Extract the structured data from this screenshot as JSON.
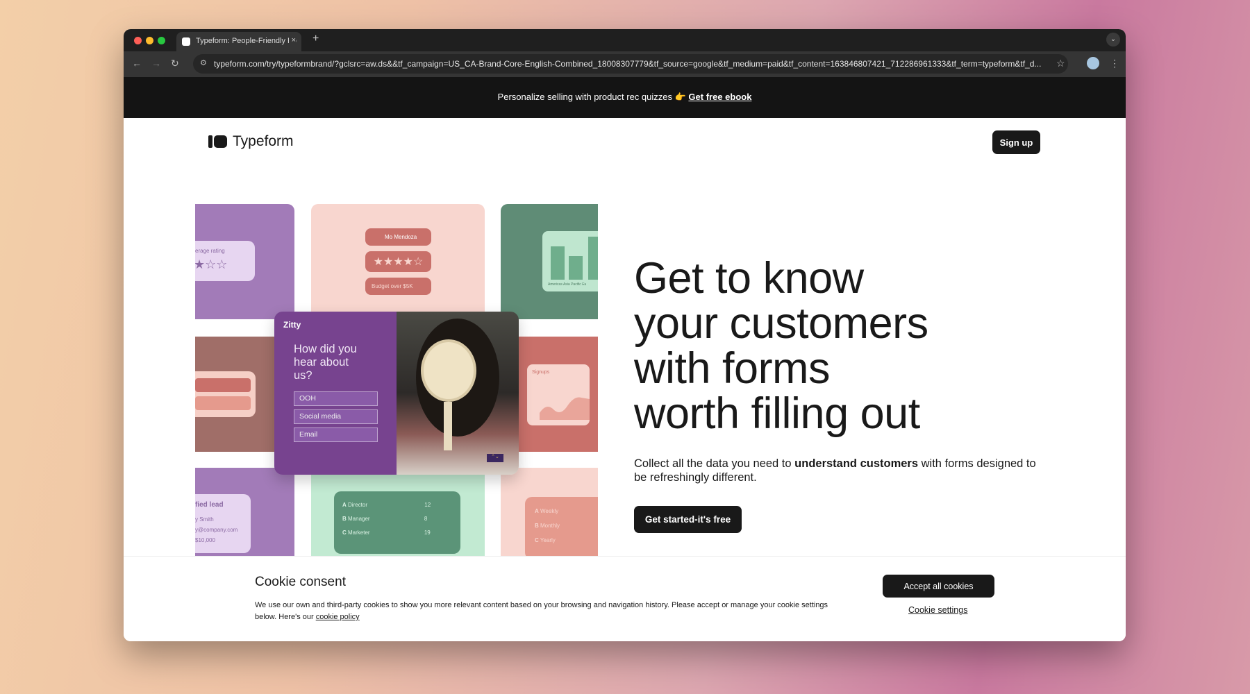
{
  "browser": {
    "tab_title": "Typeform: People-Friendly Fo",
    "url": "typeform.com/try/typeformbrand/?gclsrc=aw.ds&&tf_campaign=US_CA-Brand-Core-English-Combined_18008307779&tf_source=google&tf_medium=paid&tf_content=163846807421_712286961333&tf_term=typeform&tf_d..."
  },
  "banner": {
    "text": "Personalize selling with product rec quizzes 👉 ",
    "link": "Get free ebook"
  },
  "nav": {
    "logo": "Typeform",
    "signup": "Sign up"
  },
  "hero": {
    "headline_lines": [
      "Get to know",
      "your customers",
      "with forms",
      "worth filling out"
    ],
    "sub_pre": "Collect all the data you need to ",
    "sub_bold": "understand customers",
    "sub_post": " with forms designed to be refreshingly different.",
    "cta": "Get started-it's free"
  },
  "collage": {
    "rating_label": "erage rating",
    "person": "Mo Mendoza",
    "budget": "Budget over $5K",
    "chart_labels": [
      "Americas",
      "Asia Pacific",
      "Eu"
    ],
    "brand": "Zitty",
    "question": "How did you hear about us?",
    "options": [
      "OOH",
      "Social media",
      "Email"
    ],
    "signups": "Signups",
    "lead_title": "fied lead",
    "lead_name": "y Smith",
    "lead_email": "y@company.com",
    "lead_amount": "$10,000",
    "roles": [
      {
        "key": "A",
        "label": "Director",
        "value": "12"
      },
      {
        "key": "B",
        "label": "Manager",
        "value": "8"
      },
      {
        "key": "C",
        "label": "Marketer",
        "value": "19"
      }
    ],
    "freq": [
      {
        "key": "A",
        "label": "Weekly"
      },
      {
        "key": "B",
        "label": "Monthly"
      },
      {
        "key": "C",
        "label": "Yearly"
      }
    ]
  },
  "cookie": {
    "title": "Cookie consent",
    "text": "We use our own and third-party cookies to show you more relevant content based on your browsing and navigation history. Please accept or manage your cookie settings below. Here's our ",
    "policy": "cookie policy",
    "accept": "Accept all cookies",
    "settings": "Cookie settings"
  }
}
